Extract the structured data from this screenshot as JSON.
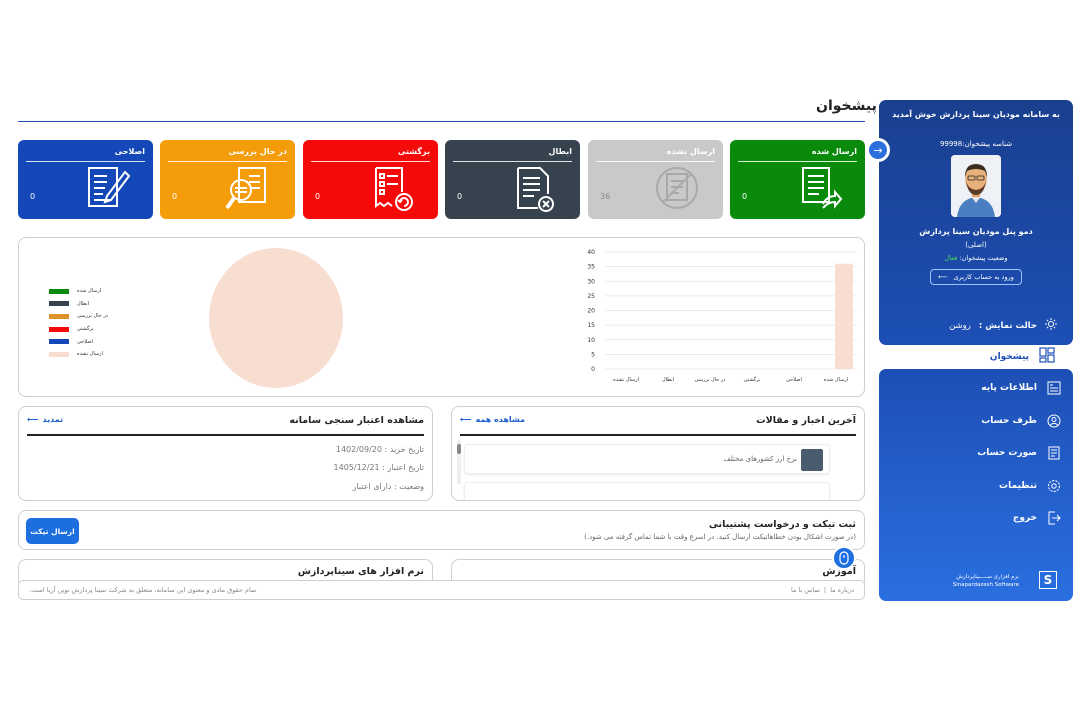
{
  "sidebar": {
    "welcome": "به سامانه مودیان سینا پردازش خوش آمدید",
    "taxpayer_id": "شناسه پیشخوان:99998",
    "user_name": "دمو پنل مودیان سینا پردازش",
    "user_role": "(اصلی)",
    "status_label": "وضعیت پیشخوان:",
    "status_value": "فعال",
    "login_button": "ورود به حساب کاربری",
    "display_mode_label": "حالت نمایش :",
    "display_mode_value": "روشن",
    "nav_active": "پیشخوان",
    "nav_items": [
      {
        "label": "اطلاعات پایه",
        "icon": "basic-info-icon"
      },
      {
        "label": "طرف حساب",
        "icon": "counterparty-icon"
      },
      {
        "label": "صورت حساب",
        "icon": "invoice-icon"
      },
      {
        "label": "تنظیمات",
        "icon": "settings-icon"
      },
      {
        "label": "خروج",
        "icon": "logout-icon"
      }
    ],
    "brand_line1": "نرم افزاری ســـــیناپردازش",
    "brand_line2": "Sinapardazesh Software"
  },
  "page": {
    "title": "پیشخوان"
  },
  "stat_cards": [
    {
      "name": "ارسال شده",
      "count": "0",
      "color": "#0a8a0a",
      "icon": "sent-document-icon"
    },
    {
      "name": "ارسال نشده",
      "count": "36",
      "color": "#c9c9c9",
      "icon": "unsent-document-icon"
    },
    {
      "name": "ابطال",
      "count": "0",
      "color": "#36424d",
      "icon": "cancel-document-icon"
    },
    {
      "name": "برگشتی",
      "count": "0",
      "color": "#f50a0a",
      "icon": "returned-invoice-icon"
    },
    {
      "name": "در حال بررسی",
      "count": "0",
      "color": "#f59c0a",
      "icon": "review-document-icon"
    },
    {
      "name": "اصلاحی",
      "count": "0",
      "color": "#1447b8",
      "icon": "edit-document-icon"
    }
  ],
  "chart_data": [
    {
      "type": "pie",
      "legend": [
        {
          "label": "ارسال شده",
          "color": "#0a8a0a"
        },
        {
          "label": "ابطال",
          "color": "#36424d"
        },
        {
          "label": "در حال بررسی",
          "color": "#e0922a"
        },
        {
          "label": "برگشتی",
          "color": "#f50a0a"
        },
        {
          "label": "اصلاحی",
          "color": "#1447b8"
        },
        {
          "label": "ارسال نشده",
          "color": "#f7ded0"
        }
      ],
      "values": [
        0,
        0,
        0,
        0,
        0,
        36
      ]
    },
    {
      "type": "bar",
      "categories": [
        "ارسال شده",
        "اصلاحی",
        "برگشتی",
        "در حال بررسی",
        "ابطال",
        "ارسال نشده"
      ],
      "values": [
        36,
        0,
        0,
        0,
        0,
        0
      ],
      "ylim": [
        0,
        40
      ],
      "yticks": [
        0,
        5,
        10,
        15,
        20,
        25,
        30,
        35,
        40
      ],
      "bar_color": "#f7ded0",
      "grid": true
    }
  ],
  "validity": {
    "title": "مشاهده اعتبار سنجی سامانه",
    "link": "تمدید",
    "purchase_date": "تاریخ خرید : 1402/09/20",
    "expiry_date": "تاریخ اعتبار : 1405/12/21",
    "status": "وضعیت : دارای اعتبار"
  },
  "news": {
    "title": "آخرین اخبار و مقالات",
    "link": "مشاهده همه",
    "items": [
      "نرخ ارز کشورهای مختلف"
    ]
  },
  "ticket": {
    "title": "ثبت تیکت و درخواست پشتیبانی",
    "description": "(در صورت اشکال بودن خطاهاتیکت ارسال کنید. در اسرع وقت با شما تماس گرفته می شود.)",
    "button": "ارسال تیکت"
  },
  "lower_panels": {
    "left": "نرم افزار های سیناپردازش",
    "right": "آموزش"
  },
  "footer": {
    "copyright": "تمام حقوق مادی و معنوی این سامانه، متعلق به شرکت سینا پردازش نوین آریا است.",
    "about": "درباره ما",
    "sep": "|",
    "contact": "تماس با ما"
  }
}
